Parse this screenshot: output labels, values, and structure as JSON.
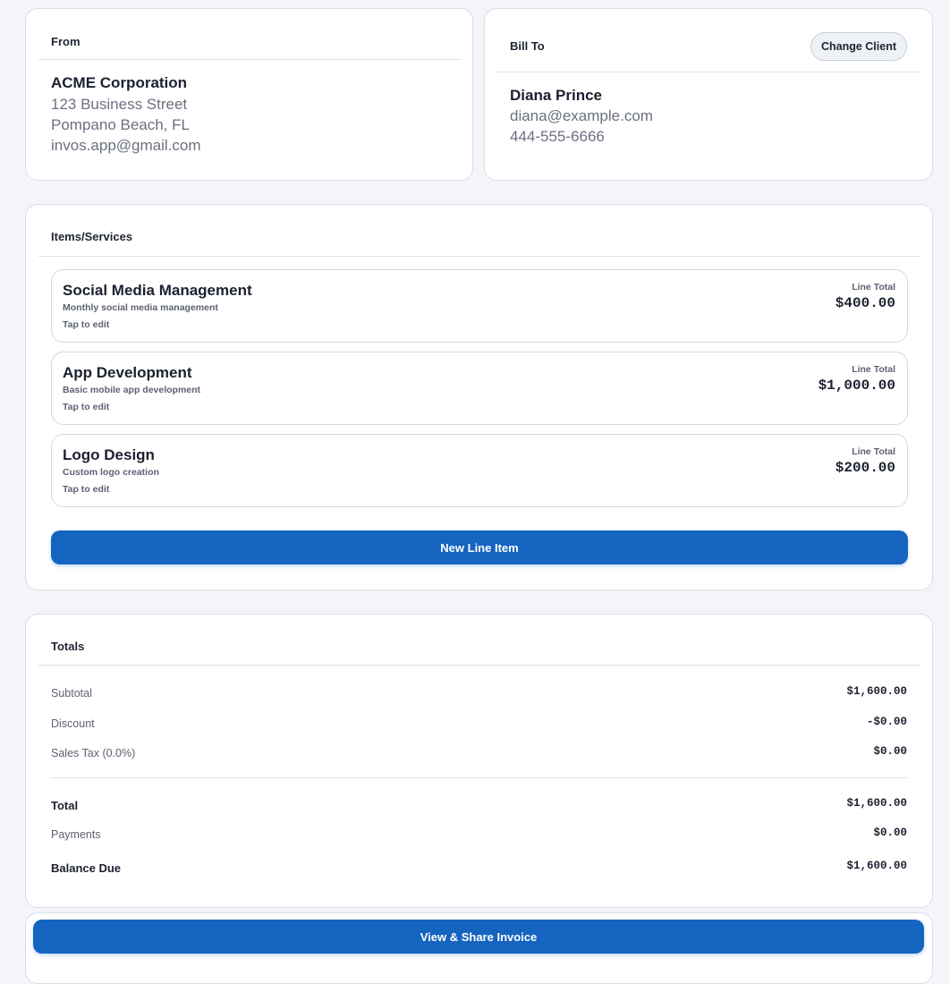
{
  "from": {
    "title": "From",
    "name": "ACME Corporation",
    "street": "123 Business Street",
    "city": "Pompano Beach, FL",
    "email": "invos.app@gmail.com"
  },
  "bill_to": {
    "title": "Bill To",
    "change_label": "Change Client",
    "name": "Diana Prince",
    "email": "diana@example.com",
    "phone": "444-555-6666"
  },
  "items": {
    "title": "Items/Services",
    "list": [
      {
        "name": "Social Media Management",
        "description": "Monthly social media management",
        "edit_hint": "Tap to edit",
        "total_label": "Line Total",
        "total": "$400.00"
      },
      {
        "name": "App Development",
        "description": "Basic mobile app development",
        "edit_hint": "Tap to edit",
        "total_label": "Line Total",
        "total": "$1,000.00"
      },
      {
        "name": "Logo Design",
        "description": "Custom logo creation",
        "edit_hint": "Tap to edit",
        "total_label": "Line Total",
        "total": "$200.00"
      }
    ],
    "new_item_label": "New Line Item"
  },
  "totals": {
    "title": "Totals",
    "subtotal_label": "Subtotal",
    "subtotal": "$1,600.00",
    "discount_label": "Discount",
    "discount": "-$0.00",
    "tax_label": "Sales Tax (0.0%)",
    "tax": "$0.00",
    "total_label": "Total",
    "total": "$1,600.00",
    "payments_label": "Payments",
    "payments": "$0.00",
    "balance_label": "Balance Due",
    "balance": "$1,600.00"
  },
  "footer": {
    "share_label": "View & Share Invoice"
  },
  "colors": {
    "primary": "#1565c0",
    "background": "#f3f5fa",
    "card": "#ffffff",
    "muted_text": "#6b7080"
  }
}
